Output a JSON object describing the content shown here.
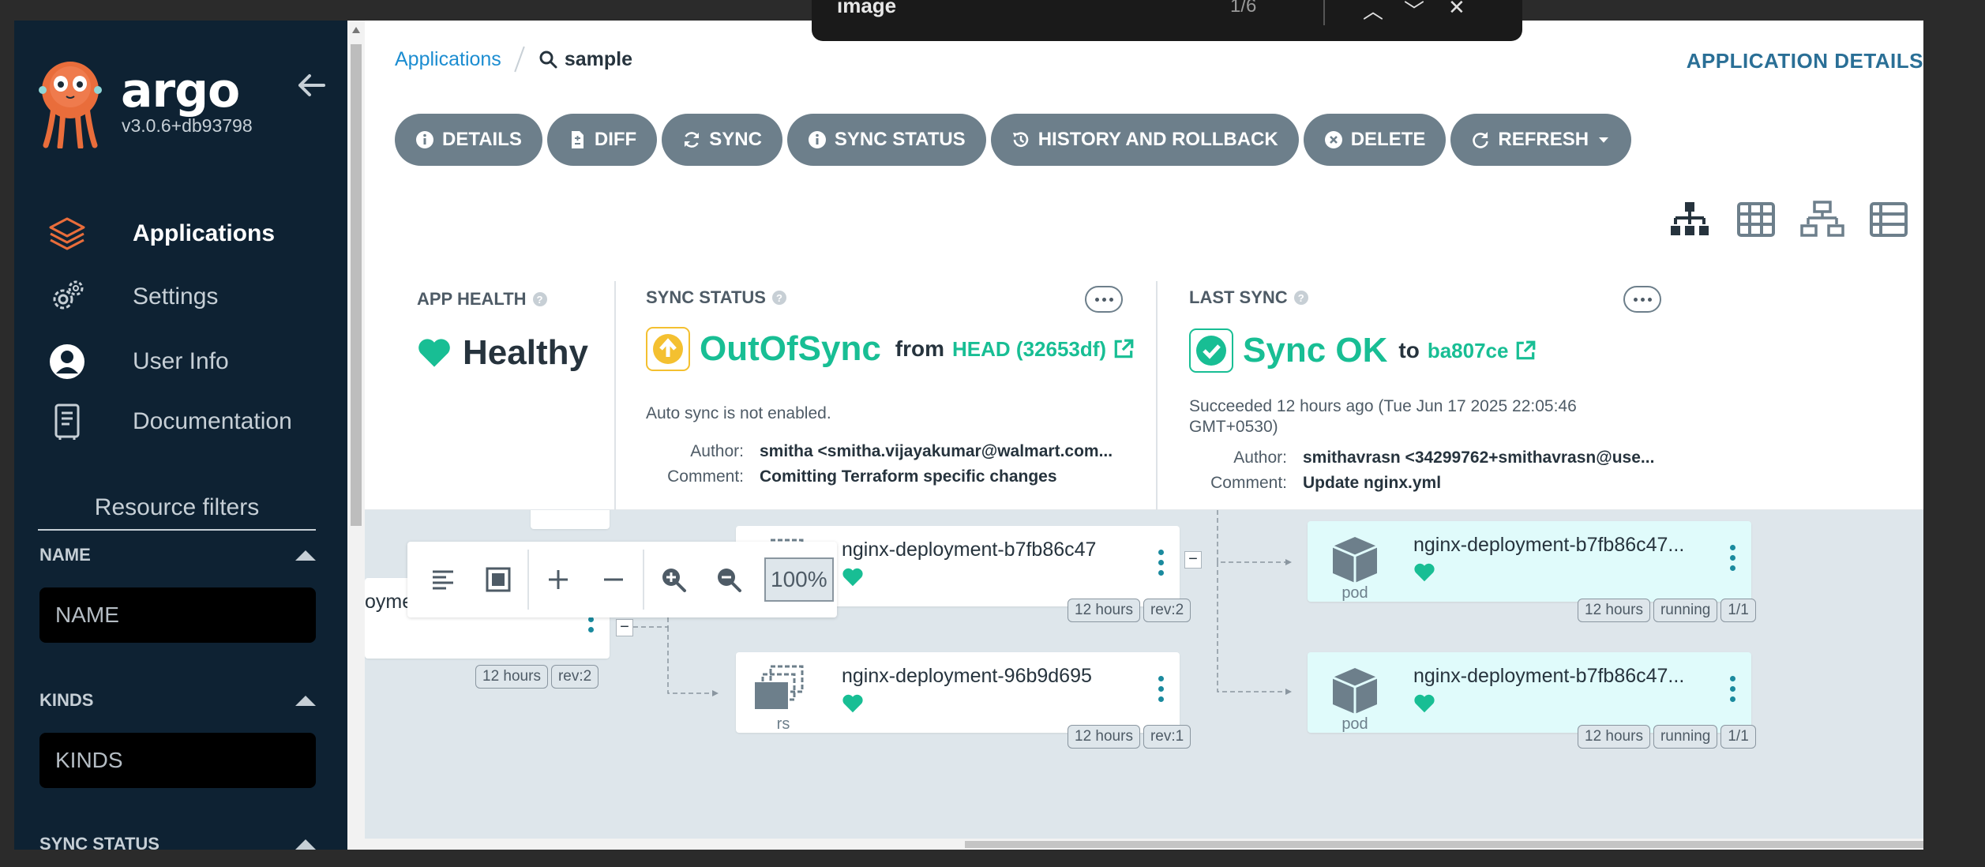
{
  "sidebar": {
    "brand": "argo",
    "version": "v3.0.6+db93798",
    "nav": [
      {
        "label": "Applications",
        "icon": "layers-icon",
        "active": true
      },
      {
        "label": "Settings",
        "icon": "gears-icon",
        "active": false
      },
      {
        "label": "User Info",
        "icon": "user-circle-icon",
        "active": false
      },
      {
        "label": "Documentation",
        "icon": "book-icon",
        "active": false
      }
    ],
    "filters_title": "Resource filters",
    "filters": [
      {
        "label": "NAME",
        "placeholder": "NAME"
      },
      {
        "label": "KINDS",
        "placeholder": "KINDS"
      },
      {
        "label": "SYNC STATUS"
      }
    ]
  },
  "breadcrumb": {
    "link": "Applications",
    "current": "sample"
  },
  "page_heading": "APPLICATION DETAILS",
  "toolbar": [
    {
      "label": "DETAILS",
      "icon": "info-icon"
    },
    {
      "label": "DIFF",
      "icon": "file-diff-icon"
    },
    {
      "label": "SYNC",
      "icon": "sync-icon"
    },
    {
      "label": "SYNC STATUS",
      "icon": "info-icon"
    },
    {
      "label": "HISTORY AND ROLLBACK",
      "icon": "history-icon"
    },
    {
      "label": "DELETE",
      "icon": "times-circle-icon"
    },
    {
      "label": "REFRESH",
      "icon": "redo-icon"
    }
  ],
  "view_l": "L",
  "app_health": {
    "label": "APP HEALTH",
    "value": "Healthy"
  },
  "sync_status": {
    "label": "SYNC STATUS",
    "value": "OutOfSync",
    "from_word": "from",
    "revision": "HEAD (32653df)",
    "note": "Auto sync is not enabled.",
    "author_key": "Author:",
    "author": "smitha <smitha.vijayakumar@walmart.com...",
    "comment_key": "Comment:",
    "comment": "Comitting Terraform specific changes"
  },
  "last_sync": {
    "label": "LAST SYNC",
    "value": "Sync OK",
    "to_word": "to",
    "revision": "ba807ce",
    "succeeded": "Succeeded 12 hours ago (Tue Jun 17 2025 22:05:46 GMT+0530)",
    "author_key": "Author:",
    "author": "smithavrasn <34299762+smithavrasn@use...",
    "comment_key": "Comment:",
    "comment": "Update nginx.yml"
  },
  "graph": {
    "partial_node": {
      "name": "oyment",
      "tags": [
        "12 hours",
        "rev:2"
      ]
    },
    "rs_nodes": [
      {
        "name": "nginx-deployment-b7fb86c47",
        "kind": "rs",
        "tags": [
          "12 hours",
          "rev:2"
        ]
      },
      {
        "name": "nginx-deployment-96b9d695",
        "kind": "rs",
        "tags": [
          "12 hours",
          "rev:1"
        ]
      }
    ],
    "pod_nodes": [
      {
        "name": "nginx-deployment-b7fb86c47...",
        "kind": "pod",
        "tags": [
          "12 hours",
          "running",
          "1/1"
        ]
      },
      {
        "name": "nginx-deployment-b7fb86c47...",
        "kind": "pod",
        "tags": [
          "12 hours",
          "running",
          "1/1"
        ]
      }
    ],
    "zoom": "100%"
  },
  "findbar": {
    "query": "image",
    "count": "1/6",
    "buttons": [
      "︿",
      "﹀",
      "✕"
    ]
  },
  "colors": {
    "accent": "#18be94",
    "sidebar": "#0e2233",
    "button": "#6d7f8b",
    "warning": "#f4c030",
    "link": "#1c8dd1"
  }
}
